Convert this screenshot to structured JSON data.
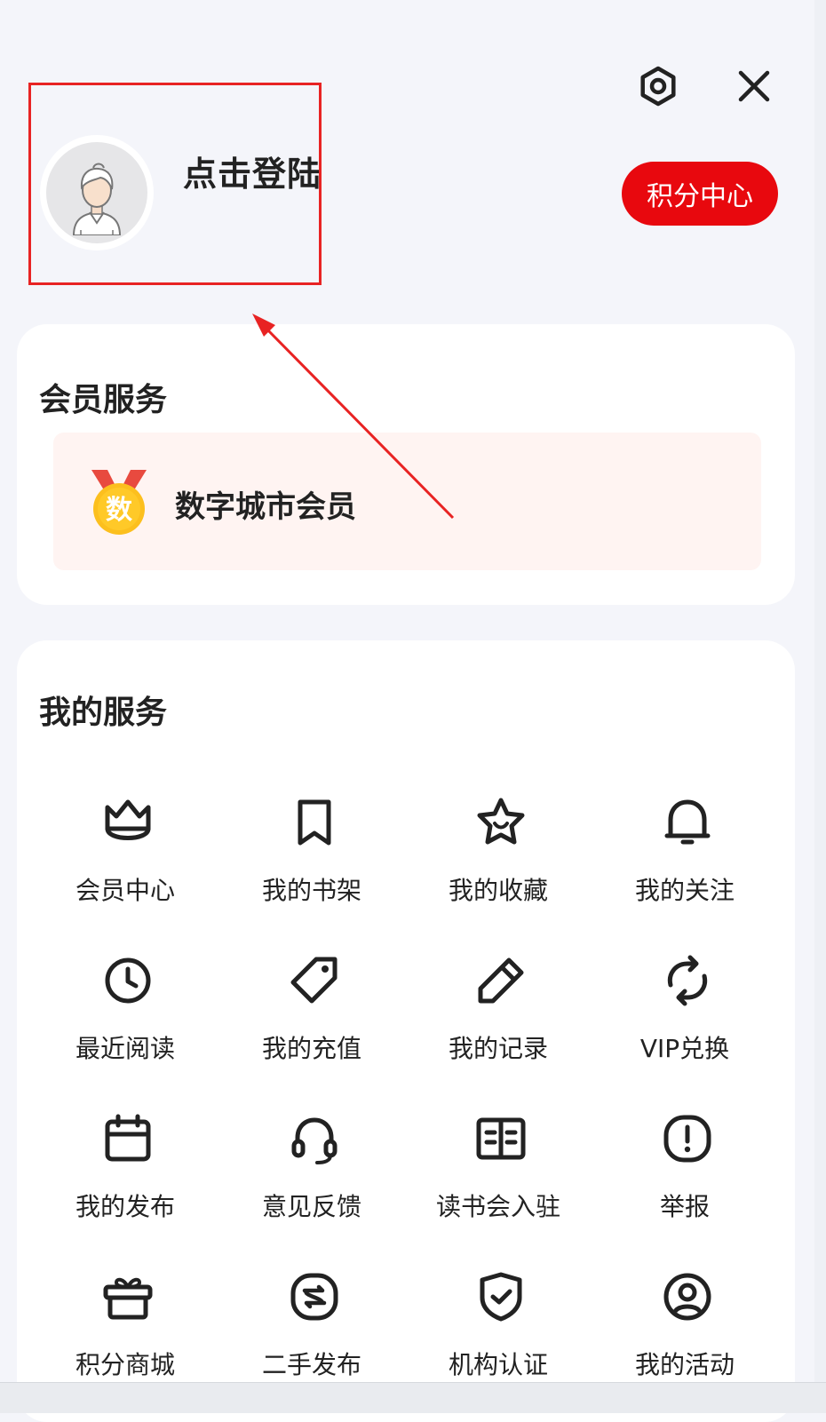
{
  "header": {
    "login_text": "点击登陆",
    "points_center_label": "积分中心"
  },
  "icons": {
    "settings": "settings-icon",
    "close": "close-icon",
    "avatar": "user-avatar-icon",
    "medal": "member-medal-icon"
  },
  "member_section": {
    "title": "会员服务",
    "vip_label": "数字城市会员",
    "medal_text": "数"
  },
  "services_section": {
    "title": "我的服务",
    "items": [
      {
        "label": "会员中心",
        "icon": "crown-icon"
      },
      {
        "label": "我的书架",
        "icon": "bookmark-icon"
      },
      {
        "label": "我的收藏",
        "icon": "star-icon"
      },
      {
        "label": "我的关注",
        "icon": "bell-icon"
      },
      {
        "label": "最近阅读",
        "icon": "clock-icon"
      },
      {
        "label": "我的充值",
        "icon": "tag-icon"
      },
      {
        "label": "我的记录",
        "icon": "pencil-icon"
      },
      {
        "label": "VIP兑换",
        "icon": "refresh-icon"
      },
      {
        "label": "我的发布",
        "icon": "calendar-icon"
      },
      {
        "label": "意见反馈",
        "icon": "headset-icon"
      },
      {
        "label": "读书会入驻",
        "icon": "book-open-icon"
      },
      {
        "label": "举报",
        "icon": "alert-icon"
      },
      {
        "label": "积分商城",
        "icon": "gift-icon"
      },
      {
        "label": "二手发布",
        "icon": "exchange-icon"
      },
      {
        "label": "机构认证",
        "icon": "shield-check-icon"
      },
      {
        "label": "我的活动",
        "icon": "user-circle-icon"
      }
    ]
  },
  "colors": {
    "accent_red": "#e8080e",
    "background": "#f4f5fa",
    "vip_row_bg": "#fff4f2",
    "annotation_red": "#e82323"
  }
}
